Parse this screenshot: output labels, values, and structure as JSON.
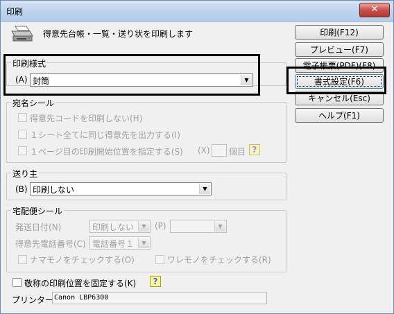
{
  "window": {
    "title": "印刷",
    "close_glyph": "✕"
  },
  "header": {
    "icon": "printer-icon",
    "message": "得意先台帳・一覧・送り状を印刷します"
  },
  "buttons": {
    "print": "印刷(F12)",
    "preview": "プレビュー(F7)",
    "pdf": "電子帳票(PDF)(F8)",
    "format": "書式設定(F6)",
    "cancel": "キャンセル(Esc)",
    "help": "ヘルプ(F1)"
  },
  "print_style": {
    "group_title": "印刷様式",
    "field_label": "(A)",
    "value": "封筒"
  },
  "address_seal": {
    "group_title": "宛名シール",
    "options": [
      "得意先コードを印刷しない(H)",
      "１シート全てに同じ得意先を出力する(I)",
      "１ページ目の印刷開始位置を指定する(S)"
    ],
    "x_label": "(X)",
    "count_suffix": "個目",
    "help_glyph": "?"
  },
  "sender": {
    "group_title": "送り主",
    "field_label": "(B)",
    "value": "印刷しない"
  },
  "delivery_seal": {
    "group_title": "宅配便シール",
    "sender_date_label": "発送日付(N)",
    "sender_date_value": "印刷しない",
    "p_label": "(P)",
    "p_value": "",
    "phone_label": "得意先電話番号(C)",
    "phone_value": "電話番号１",
    "namamono": "ナマモノをチェックする(O)",
    "waremono": "ワレモノをチェックする(R)"
  },
  "fix_honorific": {
    "label": "敬称の印刷位置を固定する(K)",
    "help_glyph": "?"
  },
  "printer": {
    "label": "プリンター",
    "value": "Canon LBP6300"
  }
}
